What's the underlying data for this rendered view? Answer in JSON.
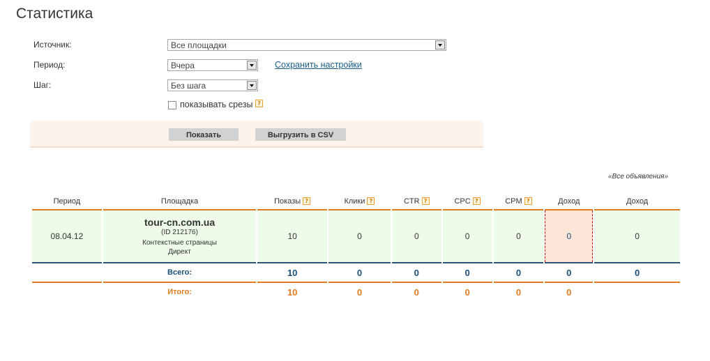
{
  "page": {
    "title": "Статистика"
  },
  "form": {
    "source": {
      "label": "Источник:",
      "value": "Все площадки"
    },
    "period": {
      "label": "Период:",
      "value": "Вчера"
    },
    "step": {
      "label": "Шаг:",
      "value": "Без шага"
    },
    "save_link": "Сохранить настройки",
    "show_slices": {
      "label": "показывать срезы",
      "checked": false
    },
    "help_mark": "?"
  },
  "actions": {
    "show": "Показать",
    "export_csv": "Выгрузить в CSV"
  },
  "table": {
    "all_ads_note": "«Все объявления»",
    "headers": {
      "period": "Период",
      "site": "Площадка",
      "impressions": "Показы",
      "clicks": "Клики",
      "ctr": "CTR",
      "cpc": "CPC",
      "cpm": "CPM",
      "income": "Доход",
      "income_all": "Доход"
    },
    "row": {
      "period": "08.04.12",
      "site_name": "tour-cn.com.ua",
      "site_id": "(ID 212176)",
      "site_type": "Контекстные страницы",
      "site_product": "Директ",
      "impressions": "10",
      "clicks": "0",
      "ctr": "0",
      "cpc": "0",
      "cpm": "0",
      "income": "0",
      "income_all": "0"
    },
    "total": {
      "label": "Всего:",
      "impressions": "10",
      "clicks": "0",
      "ctr": "0",
      "cpc": "0",
      "cpm": "0",
      "income": "0",
      "income_all": "0"
    },
    "grand_total": {
      "label": "Итого:",
      "impressions": "10",
      "clicks": "0",
      "ctr": "0",
      "cpc": "0",
      "cpm": "0",
      "income": "0"
    }
  },
  "colors": {
    "accent_orange": "#e07b1d",
    "total_blue": "#1a4f7a",
    "row_green": "#eefbe9",
    "highlight": "#fde6d8"
  }
}
